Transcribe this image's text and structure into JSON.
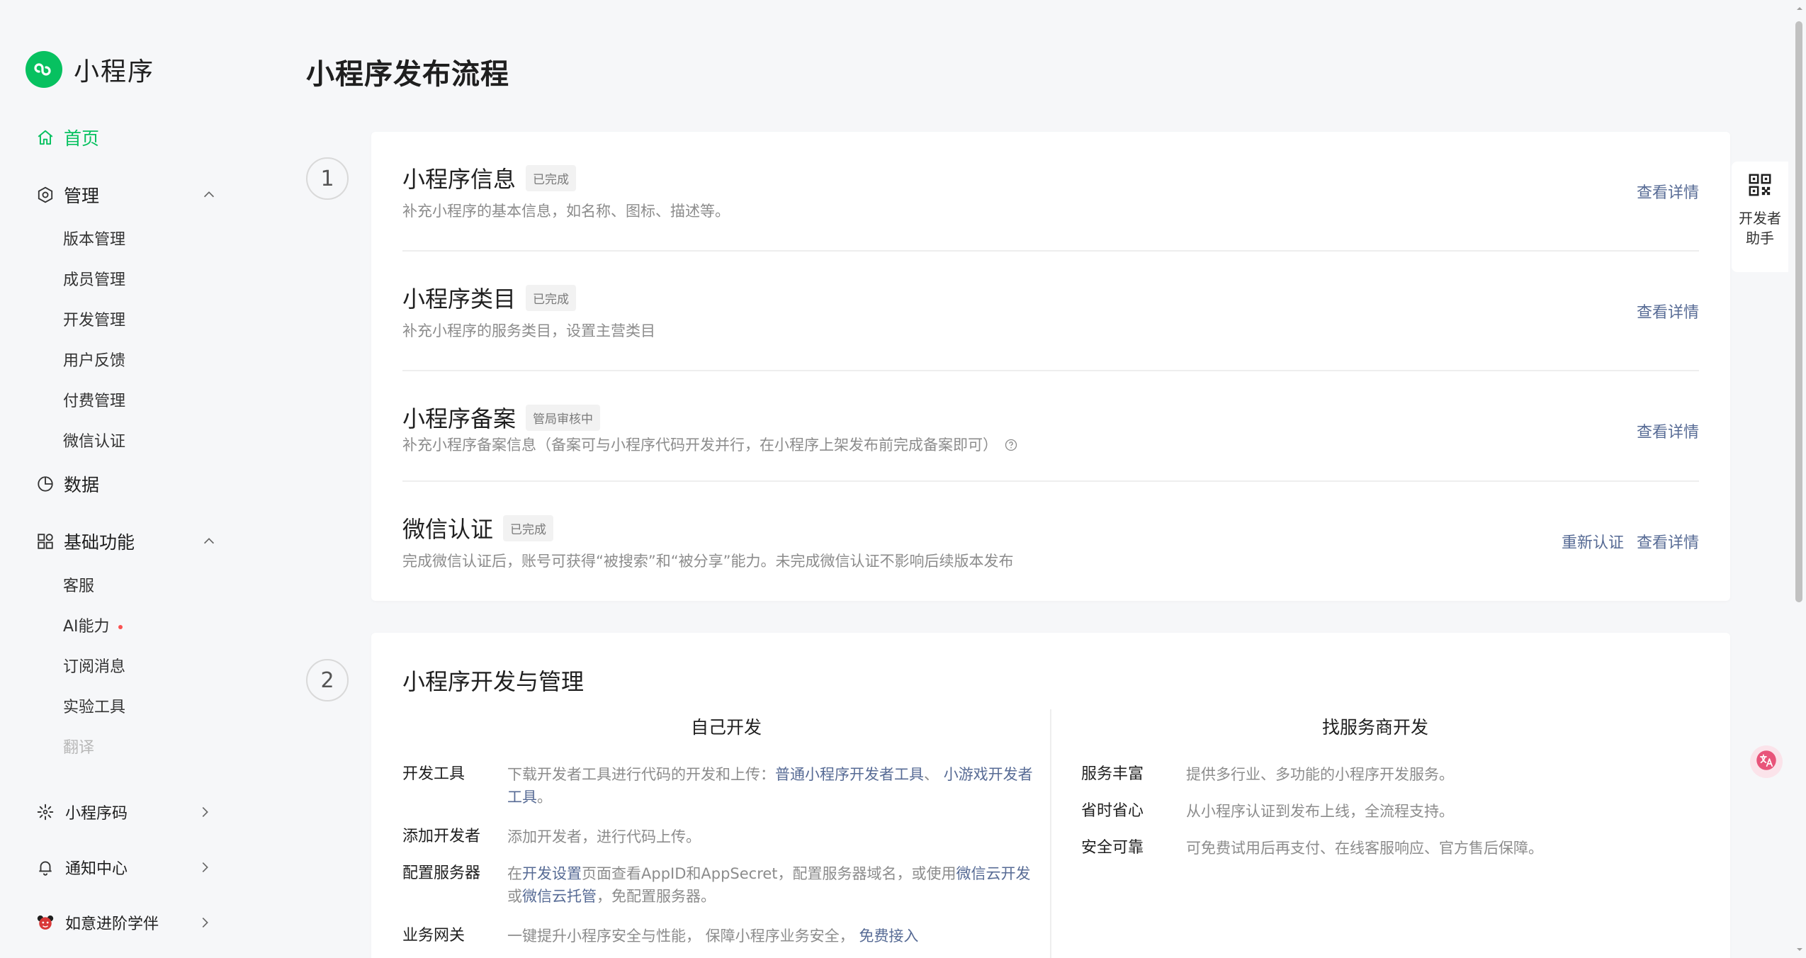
{
  "brand": {
    "title": "小程序"
  },
  "page": {
    "title": "小程序发布流程"
  },
  "sidebar": {
    "home": "首页",
    "manage": {
      "label": "管理",
      "items": [
        "版本管理",
        "成员管理",
        "开发管理",
        "用户反馈",
        "付费管理",
        "微信认证"
      ]
    },
    "data": "数据",
    "basic": {
      "label": "基础功能",
      "items": [
        "客服",
        "AI能力",
        "订阅消息",
        "实验工具",
        "翻译"
      ]
    },
    "bottom": {
      "qrcode": "小程序码",
      "notify": "通知中心",
      "account": "如意进阶学伴"
    }
  },
  "steps": {
    "step1": {
      "number": "1"
    },
    "step2": {
      "number": "2"
    }
  },
  "card1": {
    "rows": [
      {
        "title": "小程序信息",
        "status": "已完成",
        "desc": "补充小程序的基本信息，如名称、图标、描述等。",
        "actions": [
          "查看详情"
        ]
      },
      {
        "title": "小程序类目",
        "status": "已完成",
        "desc": "补充小程序的服务类目，设置主营类目",
        "actions": [
          "查看详情"
        ]
      },
      {
        "title": "小程序备案",
        "status": "管局审核中",
        "desc": "补充小程序备案信息（备案可与小程序代码开发并行，在小程序上架发布前完成备案即可）",
        "actions": [
          "查看详情"
        ]
      },
      {
        "title": "微信认证",
        "status": "已完成",
        "desc": "完成微信认证后，账号可获得“被搜索”和“被分享”能力。未完成微信认证不影响后续版本发布",
        "actions": [
          "重新认证",
          "查看详情"
        ]
      }
    ]
  },
  "card2": {
    "title": "小程序开发与管理",
    "self_dev": {
      "heading": "自己开发",
      "rows": {
        "tools": {
          "label": "开发工具",
          "text": "下载开发者工具进行代码的开发和上传：",
          "link1": "普通小程序开发者工具",
          "sep": "、 ",
          "link2": "小游戏开发者工具",
          "end": "。"
        },
        "add": {
          "label": "添加开发者",
          "text": "添加开发者，进行代码上传。"
        },
        "server": {
          "label": "配置服务器",
          "t1": "在",
          "link1": "开发设置",
          "t2": "页面查看AppID和AppSecret，配置服务器域名，或使用",
          "link2": "微信云开发",
          "t3": "或",
          "link3": "微信云托管",
          "t4": "，免配置服务器。"
        },
        "gateway": {
          "label": "业务网关",
          "text": "一键提升小程序安全与性能， 保障小程序业务安全， ",
          "link": "免费接入"
        }
      }
    },
    "vendor": {
      "heading": "找服务商开发",
      "rows": [
        {
          "label": "服务丰富",
          "text": "提供多行业、多功能的小程序开发服务。"
        },
        {
          "label": "省时省心",
          "text": "从小程序认证到发布上线，全流程支持。"
        },
        {
          "label": "安全可靠",
          "text": "可免费试用后再支付、在线客服响应、官方售后保障。"
        }
      ]
    }
  },
  "helper": {
    "label": "开发者助手"
  },
  "colors": {
    "brand": "#07c160",
    "link": "#576b95",
    "muted": "#8c8c8c",
    "dot": "#fa5151"
  }
}
